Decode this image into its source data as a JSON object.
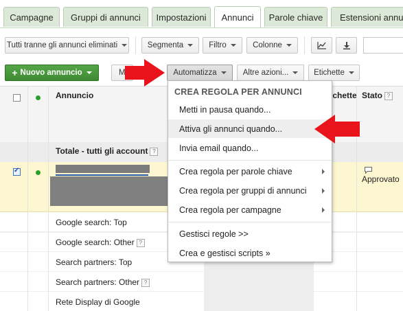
{
  "tabs": [
    "Campagne",
    "Gruppi di annunci",
    "Impostazioni",
    "Annunci",
    "Parole chiave",
    "Estensioni annun"
  ],
  "active_tab": "Annunci",
  "toolbar1": {
    "filter_label": "Tutti tranne gli annunci eliminati",
    "segment_label": "Segmenta",
    "filter2_label": "Filtro",
    "columns_label": "Colonne"
  },
  "toolbar2": {
    "new_ad_label": "Nuovo annuncio",
    "hidden_label": "M",
    "automate_label": "Automatizza",
    "more_actions_label": "Altre azioni...",
    "labels_label": "Etichette"
  },
  "table": {
    "header_ad": "Annuncio",
    "header_labels": "ichette",
    "header_status": "Stato",
    "total_label": "Totale - tutti gli account",
    "selected_status": "Approvato",
    "rows": [
      "Google search: Top",
      "Google search: Other",
      "Search partners: Top",
      "Search partners: Other",
      "Rete Display di Google"
    ]
  },
  "menu": {
    "header": "CREA REGOLA PER ANNUNCI",
    "items": [
      {
        "label": "Metti in pausa quando...",
        "submenu": false
      },
      {
        "label": "Attiva gli annunci quando...",
        "submenu": false
      },
      {
        "label": "Invia email quando...",
        "submenu": false
      },
      {
        "label": "Crea regola per parole chiave",
        "submenu": true
      },
      {
        "label": "Crea regola per gruppi di annunci",
        "submenu": true
      },
      {
        "label": "Crea regola per campagne",
        "submenu": true
      },
      {
        "label": "Gestisci regole >>",
        "submenu": false
      },
      {
        "label": "Crea e gestisci scripts »",
        "submenu": false
      }
    ]
  },
  "colors": {
    "accent_green": "#3e8a33",
    "arrow_red": "#e8131b",
    "selected_row": "#fdf7d1"
  }
}
